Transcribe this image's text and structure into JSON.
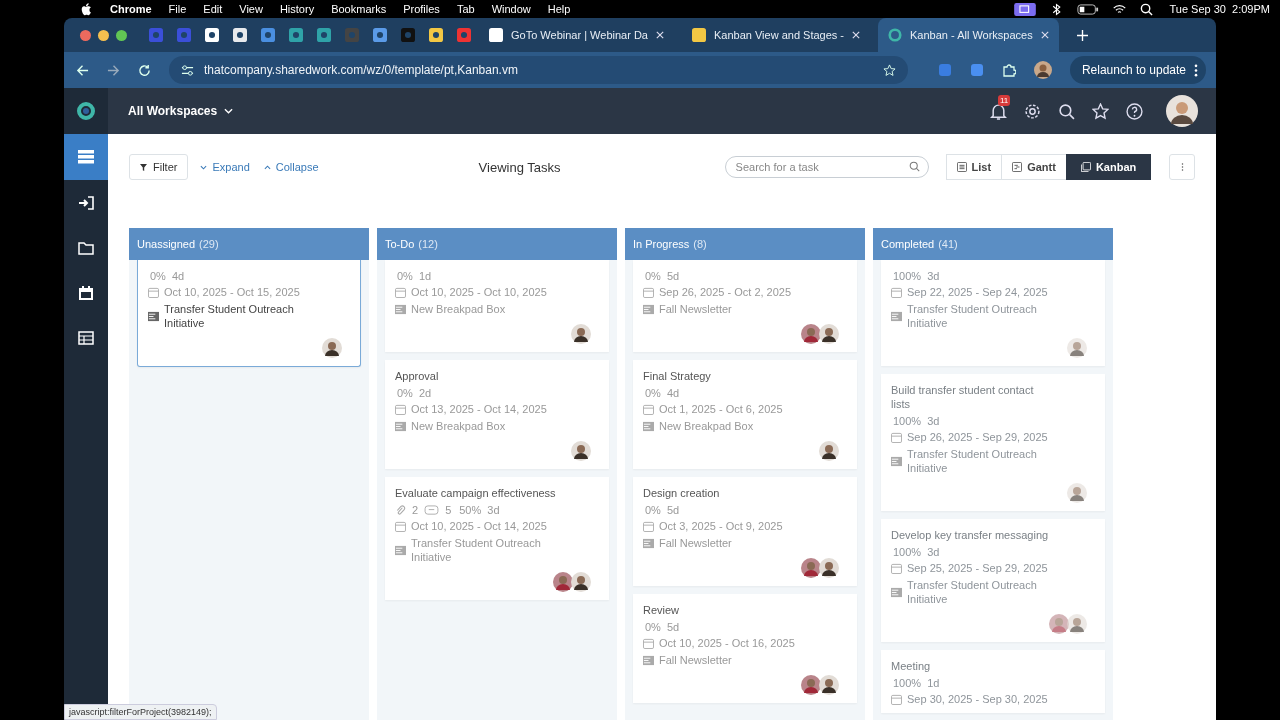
{
  "menubar": {
    "app": "Chrome",
    "items": [
      "File",
      "Edit",
      "View",
      "History",
      "Bookmarks",
      "Profiles",
      "Tab",
      "Window",
      "Help"
    ],
    "clock": "Tue Sep 30  2:09PM"
  },
  "browser": {
    "tabs": [
      {
        "label": "GoTo Webinar | Webinar Da",
        "selected": false
      },
      {
        "label": "Kanban View and Stages -",
        "selected": false
      },
      {
        "label": "Kanban - All Workspaces",
        "selected": true
      }
    ],
    "url": "thatcompany.sharedwork.com/wz/0/template/pt,Kanban.vm",
    "relaunch": "Relaunch to update",
    "status": "javascript:filterForProject(3982149);"
  },
  "header": {
    "workspace": "All Workspaces",
    "notifications": "11"
  },
  "sidebar": {
    "items": [
      {
        "kind": "board",
        "selected": true
      },
      {
        "kind": "login",
        "selected": false
      },
      {
        "kind": "folder",
        "selected": false
      },
      {
        "kind": "calendar",
        "selected": false
      },
      {
        "kind": "table",
        "selected": false
      }
    ]
  },
  "toolbar": {
    "filter": "Filter",
    "expand": "Expand",
    "collapse": "Collapse",
    "title": "Viewing Tasks",
    "search": {
      "placeholder": "Search for a task"
    },
    "views": [
      {
        "kind": "list",
        "label": "List",
        "selected": false
      },
      {
        "kind": "gantt",
        "label": "Gantt",
        "selected": false
      },
      {
        "kind": "kanban",
        "label": "Kanban",
        "selected": true
      }
    ]
  },
  "columns": [
    {
      "name": "Unassigned",
      "count": "(29)",
      "dimmed": false,
      "cards": [
        {
          "selected": true,
          "progress": "0%",
          "duration": "4d",
          "dates": "Oct 10, 2025 - Oct 15, 2025",
          "project": "Transfer Student Outreach Initiative"
        }
      ]
    },
    {
      "name": "To-Do",
      "count": "(12)",
      "dimmed": false,
      "cards": [
        {
          "selected": false,
          "progress": "0%",
          "duration": "1d",
          "dates": "Oct 10, 2025 - Oct 10, 2025",
          "project": "New Breakpad Box"
        },
        {
          "selected": false,
          "title": "Approval",
          "progress": "0%",
          "duration": "2d",
          "dates": "Oct 13, 2025 - Oct 14, 2025",
          "project": "New Breakpad Box"
        },
        {
          "selected": false,
          "title": "Evaluate campaign effectiveness",
          "attachments": "2",
          "comments": "5",
          "progress": "50%",
          "duration": "3d",
          "dates": "Oct 10, 2025 - Oct 14, 2025",
          "project": "Transfer Student Outreach Initiative"
        }
      ]
    },
    {
      "name": "In Progress",
      "count": "(8)",
      "dimmed": false,
      "cards": [
        {
          "selected": false,
          "progress": "0%",
          "duration": "5d",
          "dates": "Sep 26, 2025 - Oct 2, 2025",
          "project": "Fall Newsletter"
        },
        {
          "selected": false,
          "title": "Final Strategy",
          "progress": "0%",
          "duration": "4d",
          "dates": "Oct 1, 2025 - Oct 6, 2025",
          "project": "New Breakpad Box"
        },
        {
          "selected": false,
          "title": "Design creation",
          "progress": "0%",
          "duration": "5d",
          "dates": "Oct 3, 2025 - Oct 9, 2025",
          "project": "Fall Newsletter"
        },
        {
          "selected": false,
          "title": "Review",
          "progress": "0%",
          "duration": "5d",
          "dates": "Oct 10, 2025 - Oct 16, 2025",
          "project": "Fall Newsletter"
        }
      ]
    },
    {
      "name": "Completed",
      "count": "(41)",
      "dimmed": true,
      "cards": [
        {
          "selected": false,
          "progress": "100%",
          "duration": "3d",
          "dates": "Sep 22, 2025 - Sep 24, 2025",
          "project": "Transfer Student Outreach Initiative"
        },
        {
          "selected": false,
          "title": "Build transfer student contact lists",
          "progress": "100%",
          "duration": "3d",
          "dates": "Sep 26, 2025 - Sep 29, 2025",
          "project": "Transfer Student Outreach Initiative"
        },
        {
          "selected": false,
          "title": "Develop key transfer messaging",
          "progress": "100%",
          "duration": "3d",
          "dates": "Sep 25, 2025 - Sep 29, 2025",
          "project": "Transfer Student Outreach Initiative"
        },
        {
          "selected": false,
          "title": "Meeting",
          "progress": "100%",
          "duration": "1d",
          "dates": "Sep 30, 2025 - Sep 30, 2025"
        }
      ]
    }
  ]
}
